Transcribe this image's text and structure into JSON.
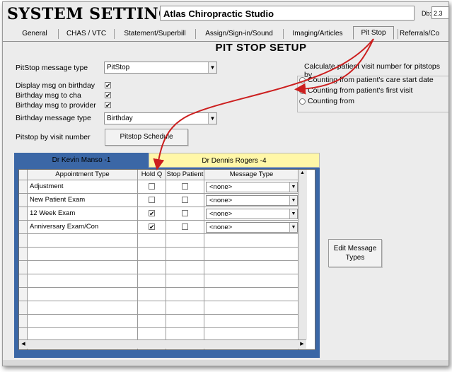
{
  "header": {
    "title": "SYSTEM SETTINGS",
    "clinic_name": "Atlas Chiropractic Studio",
    "db_label": "Db:",
    "db_value": "2.3"
  },
  "tabs": [
    {
      "label": "General"
    },
    {
      "label": "CHAS / VTC"
    },
    {
      "label": "Statement/Superbill"
    },
    {
      "label": "Assign/Sign-in/Sound"
    },
    {
      "label": "Imaging/Articles"
    },
    {
      "label": "Pit Stop",
      "active": true
    },
    {
      "label": "Referrals/Co"
    }
  ],
  "section_title": "PIT STOP SETUP",
  "form": {
    "message_type_label": "PitStop message type",
    "message_type_value": "PitStop",
    "display_birthday_label": "Display msg on birthday",
    "display_birthday_checked": "✔",
    "birthday_cha_label": "Birthday msg to cha",
    "birthday_cha_checked": "✔",
    "birthday_provider_label": "Birthday msg to provider",
    "birthday_provider_checked": "✔",
    "birthday_message_type_label": "Birthday message type",
    "birthday_message_type_value": "Birthday",
    "visit_number_label": "Pitstop by visit number",
    "schedule_button": "Pitstop Schedule"
  },
  "visit_calc": {
    "title": "Calculate patient visit number for pitstops by",
    "options": [
      {
        "label": "Counting from patient's care start date",
        "selected": false
      },
      {
        "label": "Counting from patient's first visit",
        "selected": true
      },
      {
        "label": "Counting from",
        "selected": false
      }
    ]
  },
  "doctors": {
    "doctor1": "Dr Kevin Manso  -1",
    "doctor2": "Dr Dennis Rogers  -4"
  },
  "grid": {
    "headers": [
      "Appointment Type",
      "Hold Q",
      "Stop Patient",
      "Message Type"
    ],
    "rows": [
      {
        "type": "Adjustment",
        "hold": "",
        "stop": "",
        "message": "<none>"
      },
      {
        "type": "New Patient Exam",
        "hold": "",
        "stop": "",
        "message": "<none>"
      },
      {
        "type": "12 Week Exam",
        "hold": "✔",
        "stop": "",
        "message": "<none>"
      },
      {
        "type": "Anniversary Exam/Con",
        "hold": "✔",
        "stop": "",
        "message": "<none>"
      }
    ]
  },
  "edit_button": "Edit Message Types",
  "colors": {
    "panel": "#3b67a6",
    "doctor2_bg": "#fff7a8",
    "arrow": "#cc1f1f"
  }
}
